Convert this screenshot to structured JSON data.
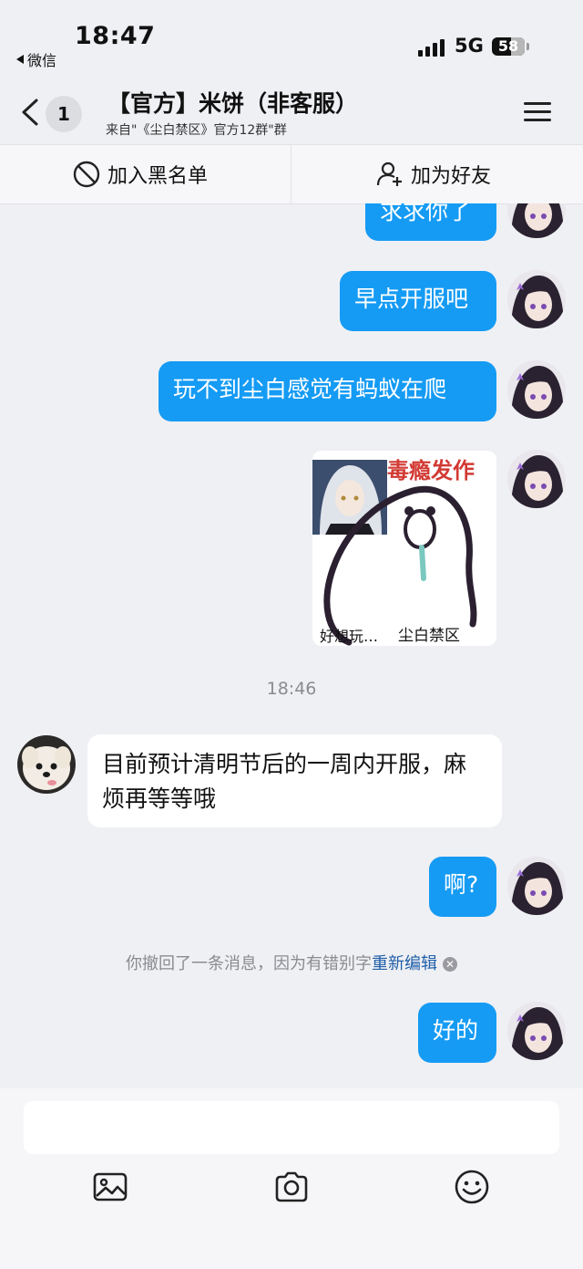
{
  "status_bar": {
    "time": "18:47",
    "back_app": "微信",
    "network": "5G",
    "battery": "58",
    "battery_level": 0.58
  },
  "header": {
    "unread_count": "1",
    "title": "【官方】米饼（非客服）",
    "subtitle": "来自\"《尘白禁区》官方12群\"群"
  },
  "actions": {
    "block_label": "加入黑名单",
    "add_friend_label": "加为好友"
  },
  "messages": [
    {
      "sender": "me",
      "text": "求求你了"
    },
    {
      "sender": "me",
      "text": "早点开服吧"
    },
    {
      "sender": "me",
      "text": "玩不到尘白感觉有蚂蚁在爬"
    },
    {
      "sender": "me",
      "type": "sticker",
      "sticker_title": "毒瘾发作",
      "caption_left": "好想玩…",
      "caption_right": "尘白禁区"
    },
    {
      "type": "timestamp",
      "text": "18:46"
    },
    {
      "sender": "other",
      "text": "目前预计清明节后的一周内开服，麻烦再等等哦"
    },
    {
      "sender": "me",
      "text": "啊?"
    },
    {
      "type": "system",
      "text": "你撤回了一条消息，因为有错别字",
      "action": "重新编辑"
    },
    {
      "sender": "me",
      "text": "好的"
    }
  ],
  "colors": {
    "my_bubble": "#159bf4",
    "other_bubble": "#ffffff",
    "background": "#eff0f4",
    "link": "#1f5fa8"
  },
  "toolbar": {
    "icons": [
      "image-icon",
      "camera-icon",
      "emoji-icon"
    ]
  }
}
